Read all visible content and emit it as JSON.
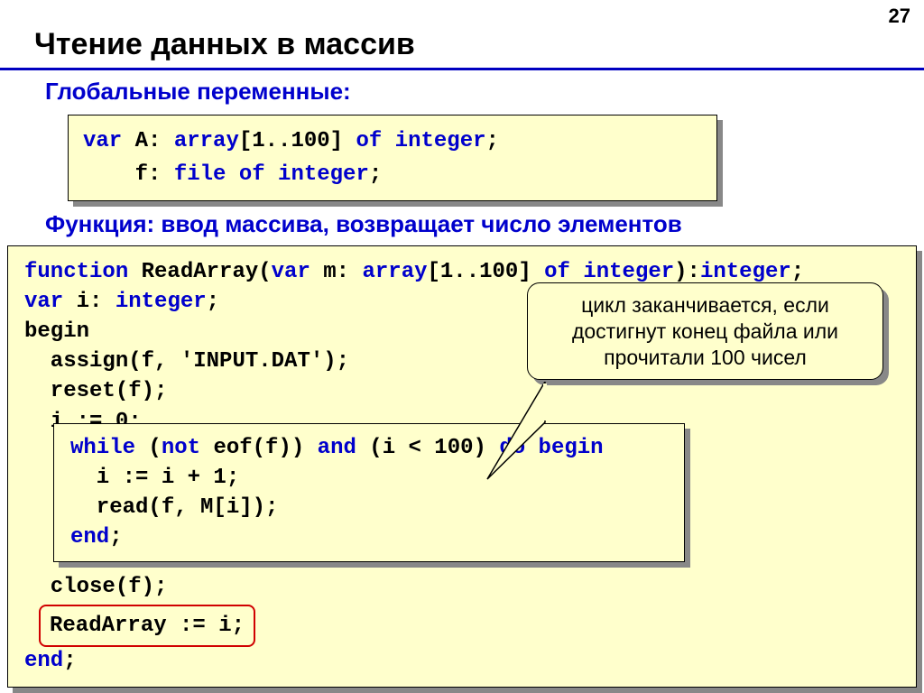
{
  "page_number": "27",
  "title": "Чтение данных в массив",
  "subtitle_globals": "Глобальные переменные:",
  "globals_code_l1a": "var",
  "globals_code_l1b": " A: ",
  "globals_code_l1c": "array",
  "globals_code_l1d": "[1..100] ",
  "globals_code_l1e": "of integer",
  "globals_code_l1f": ";",
  "globals_code_l2a": "    f: ",
  "globals_code_l2b": "file of integer",
  "globals_code_l2c": ";",
  "subtitle_function": "Функция: ввод массива, возвращает число элементов",
  "fn_l1a": "function",
  "fn_l1b": " ReadArray(",
  "fn_l1c": "var",
  "fn_l1d": " m: ",
  "fn_l1e": "array",
  "fn_l1f": "[1..100] ",
  "fn_l1g": "of integer",
  "fn_l1h": "):",
  "fn_l1i": "integer",
  "fn_l1j": ";",
  "fn_l2a": "var",
  "fn_l2b": " i: ",
  "fn_l2c": "integer",
  "fn_l2d": ";",
  "fn_l3": "begin",
  "fn_l4": "  assign(f, 'INPUT.DAT');",
  "fn_l5": "  reset(f);",
  "fn_l6": "  i := 0;",
  "inner_l1a": "while",
  "inner_l1b": " (",
  "inner_l1c": "not",
  "inner_l1d": " eof(f)) ",
  "inner_l1e": "and",
  "inner_l1f": " (i < 100) ",
  "inner_l1g": "do begin",
  "inner_l2": "  i := i + 1;",
  "inner_l3": "  read(f, M[i]);",
  "inner_l4": "end",
  "inner_l4b": ";",
  "fn_l7": "  close(f);",
  "fn_result": "ReadArray := i;",
  "fn_end": "end",
  "fn_end_semi": ";",
  "callout_text": "цикл заканчивается, если достигнут конец файла или прочитали 100 чисел"
}
